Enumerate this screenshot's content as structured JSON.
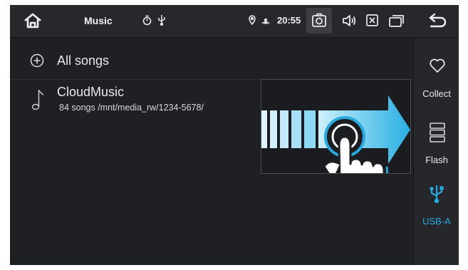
{
  "statusbar": {
    "title": "Music",
    "time": "20:55",
    "icons": [
      "home-icon",
      "timer-icon",
      "usb-icon",
      "location-icon",
      "cast-icon",
      "camera-icon",
      "volume-icon",
      "close-box-icon",
      "windows-icon",
      "back-icon"
    ]
  },
  "list": {
    "all_songs": "All songs",
    "items": [
      {
        "title": "CloudMusic",
        "subtitle": "84 songs /mnt/media_rw/1234-5678/"
      }
    ]
  },
  "sidebar": {
    "items": [
      {
        "label": "Collect",
        "icon": "heart-icon"
      },
      {
        "label": "Flash",
        "icon": "storage-icon"
      },
      {
        "label": "USB-A",
        "icon": "usb-icon",
        "active": true
      }
    ]
  },
  "colors": {
    "accent": "#2aa8e0",
    "background": "#1e2024",
    "arrow": "#33b5e6"
  }
}
